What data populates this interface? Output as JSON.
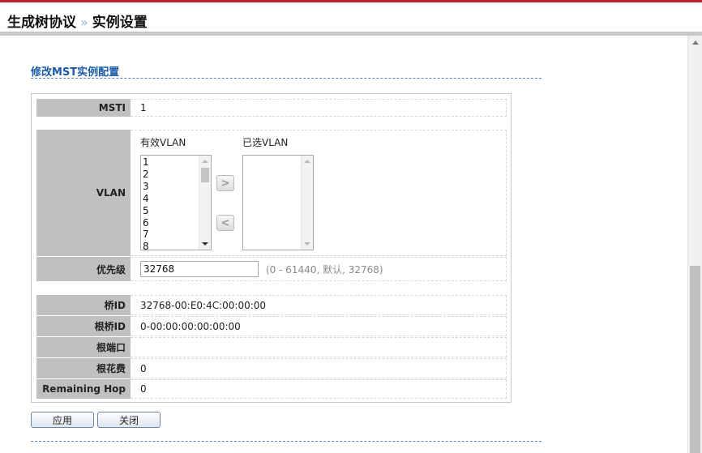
{
  "breadcrumb": {
    "parent": "生成树协议",
    "separator": "»",
    "current": "实例设置"
  },
  "section_title": "修改MST实例配置",
  "fields": {
    "msti": {
      "label": "MSTI",
      "value": "1"
    },
    "vlan": {
      "label": "VLAN",
      "available_caption": "有效VLAN",
      "selected_caption": "已选VLAN",
      "available_items": [
        "1",
        "2",
        "3",
        "4",
        "5",
        "6",
        "7",
        "8"
      ],
      "add_glyph": ">",
      "remove_glyph": "<"
    },
    "priority": {
      "label": "优先级",
      "value": "32768",
      "hint": "(0 - 61440, 默认, 32768)"
    },
    "bridge_id": {
      "label": "桥ID",
      "value": "32768-00:E0:4C:00:00:00"
    },
    "root_bridge_id": {
      "label": "根桥ID",
      "value": "0-00:00:00:00:00:00"
    },
    "root_port": {
      "label": "根端口",
      "value": ""
    },
    "root_cost": {
      "label": "根花费",
      "value": "0"
    },
    "remaining_hop": {
      "label": "Remaining Hop",
      "value": "0"
    }
  },
  "buttons": {
    "apply": "应用",
    "close": "关闭"
  },
  "colors": {
    "accent_red": "#b8232f",
    "title_blue": "#1b5aa8",
    "label_bg": "#c0c0c0"
  }
}
